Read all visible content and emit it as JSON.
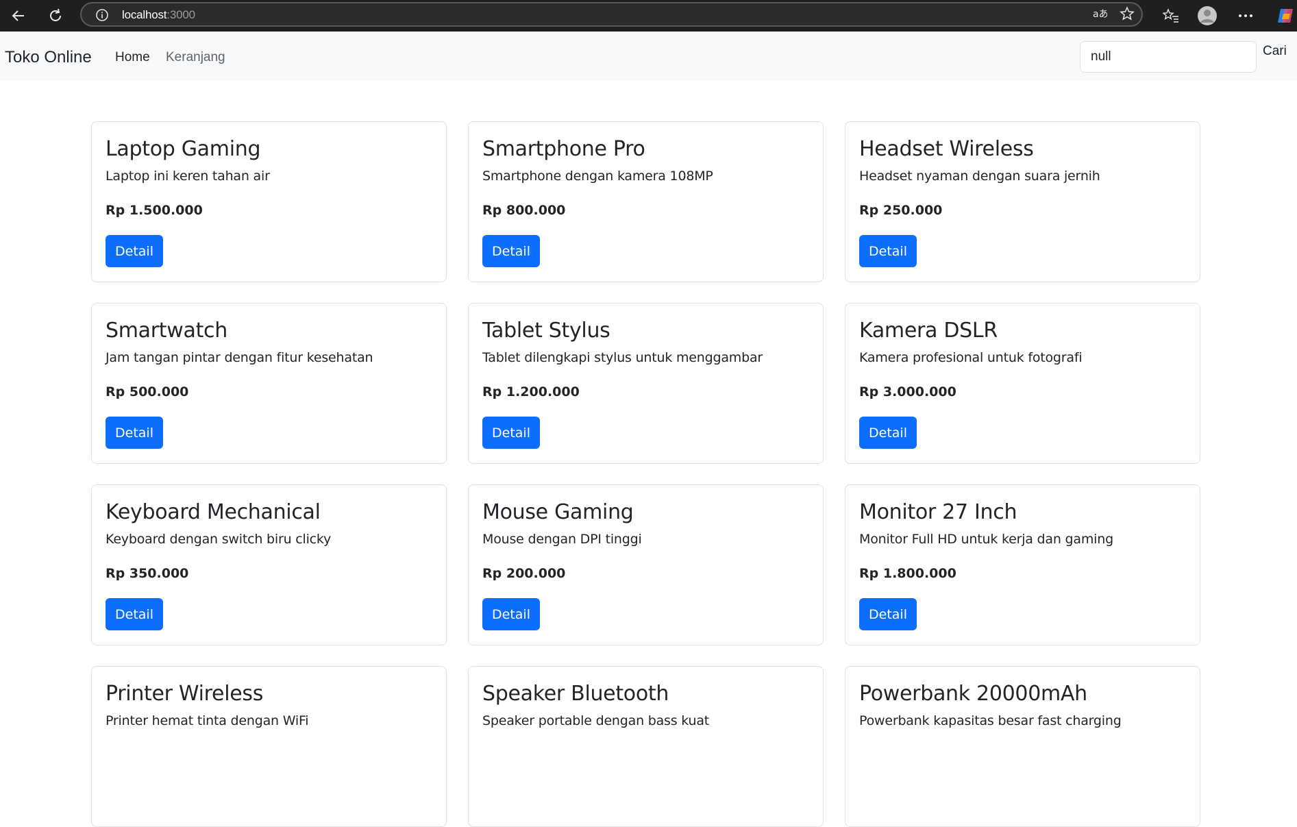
{
  "browser": {
    "url_host": "localhost",
    "url_port": ":3000"
  },
  "navbar": {
    "brand": "Toko Online",
    "links": [
      "Home",
      "Keranjang"
    ],
    "search_value": "null",
    "search_button": "Cari"
  },
  "colors": {
    "primary": "#0d6efd",
    "navbar_bg": "#f8f9fa",
    "chrome_bg": "#1f1f1f"
  },
  "products": [
    {
      "name": "Laptop Gaming",
      "desc": "Laptop ini keren tahan air",
      "price": "Rp 1.500.000",
      "button": "Detail"
    },
    {
      "name": "Smartphone Pro",
      "desc": "Smartphone dengan kamera 108MP",
      "price": "Rp 800.000",
      "button": "Detail"
    },
    {
      "name": "Headset Wireless",
      "desc": "Headset nyaman dengan suara jernih",
      "price": "Rp 250.000",
      "button": "Detail"
    },
    {
      "name": "Smartwatch",
      "desc": "Jam tangan pintar dengan fitur kesehatan",
      "price": "Rp 500.000",
      "button": "Detail"
    },
    {
      "name": "Tablet Stylus",
      "desc": "Tablet dilengkapi stylus untuk menggambar",
      "price": "Rp 1.200.000",
      "button": "Detail"
    },
    {
      "name": "Kamera DSLR",
      "desc": "Kamera profesional untuk fotografi",
      "price": "Rp 3.000.000",
      "button": "Detail"
    },
    {
      "name": "Keyboard Mechanical",
      "desc": "Keyboard dengan switch biru clicky",
      "price": "Rp 350.000",
      "button": "Detail"
    },
    {
      "name": "Mouse Gaming",
      "desc": "Mouse dengan DPI tinggi",
      "price": "Rp 200.000",
      "button": "Detail"
    },
    {
      "name": "Monitor 27 Inch",
      "desc": "Monitor Full HD untuk kerja dan gaming",
      "price": "Rp 1.800.000",
      "button": "Detail"
    },
    {
      "name": "Printer Wireless",
      "desc": "Printer hemat tinta dengan WiFi",
      "price": "",
      "button": ""
    },
    {
      "name": "Speaker Bluetooth",
      "desc": "Speaker portable dengan bass kuat",
      "price": "",
      "button": ""
    },
    {
      "name": "Powerbank 20000mAh",
      "desc": "Powerbank kapasitas besar fast charging",
      "price": "",
      "button": ""
    }
  ]
}
